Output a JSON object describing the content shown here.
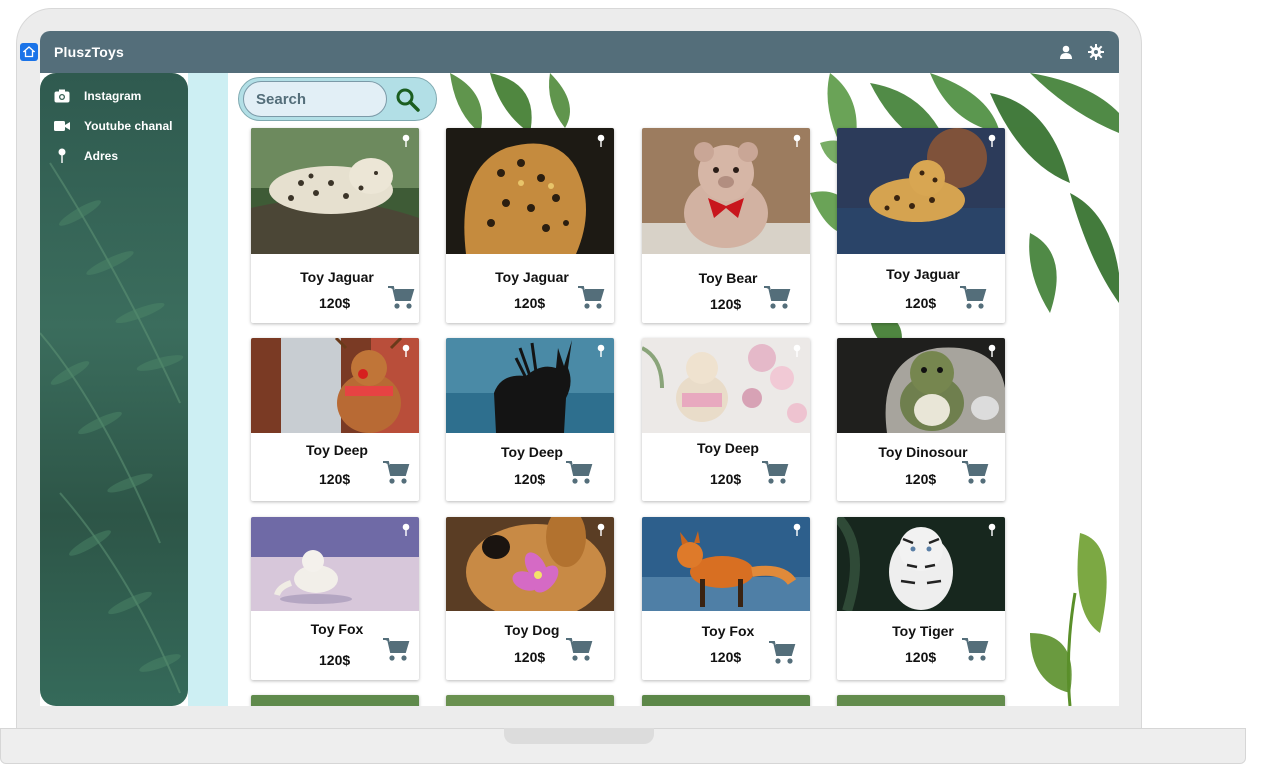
{
  "app": {
    "brand": "PluszToys"
  },
  "sidebar": {
    "items": [
      {
        "label": "Instagram",
        "icon": "camera-icon"
      },
      {
        "label": "Youtube chanal",
        "icon": "video-camera-icon"
      },
      {
        "label": "Adres",
        "icon": "location-pin-icon"
      }
    ]
  },
  "search": {
    "placeholder": "Search"
  },
  "products": [
    {
      "name": "Toy Jaguar",
      "price": "120$",
      "image": "snow leopard lying on branch"
    },
    {
      "name": "Toy Jaguar",
      "price": "120$",
      "image": "jaguar close-up"
    },
    {
      "name": "Toy Bear",
      "price": "120$",
      "image": "pink teddy bear with red bow"
    },
    {
      "name": "Toy Jaguar",
      "price": "120$",
      "image": "plush leopard toy"
    },
    {
      "name": "Toy Deep",
      "price": "120$",
      "image": "plush reindeer with scarf"
    },
    {
      "name": "Toy Deep",
      "price": "120$",
      "image": "deer silhouette over water"
    },
    {
      "name": "Toy Deep",
      "price": "120$",
      "image": "crochet deer toy"
    },
    {
      "name": "Toy Dinosour",
      "price": "120$",
      "image": "green plush dinosaur"
    },
    {
      "name": "Toy Fox",
      "price": "120$",
      "image": "arctic fox in snow"
    },
    {
      "name": "Toy Dog",
      "price": "120$",
      "image": "golden retriever with flower"
    },
    {
      "name": "Toy Fox",
      "price": "120$",
      "image": "red fox standing"
    },
    {
      "name": "Toy Tiger",
      "price": "120$",
      "image": "white tiger"
    }
  ],
  "colors": {
    "topbar": "#546e7a",
    "accent": "#546e7a",
    "search_bg": "#b2dfe6",
    "search_icon": "#1b5e20"
  }
}
